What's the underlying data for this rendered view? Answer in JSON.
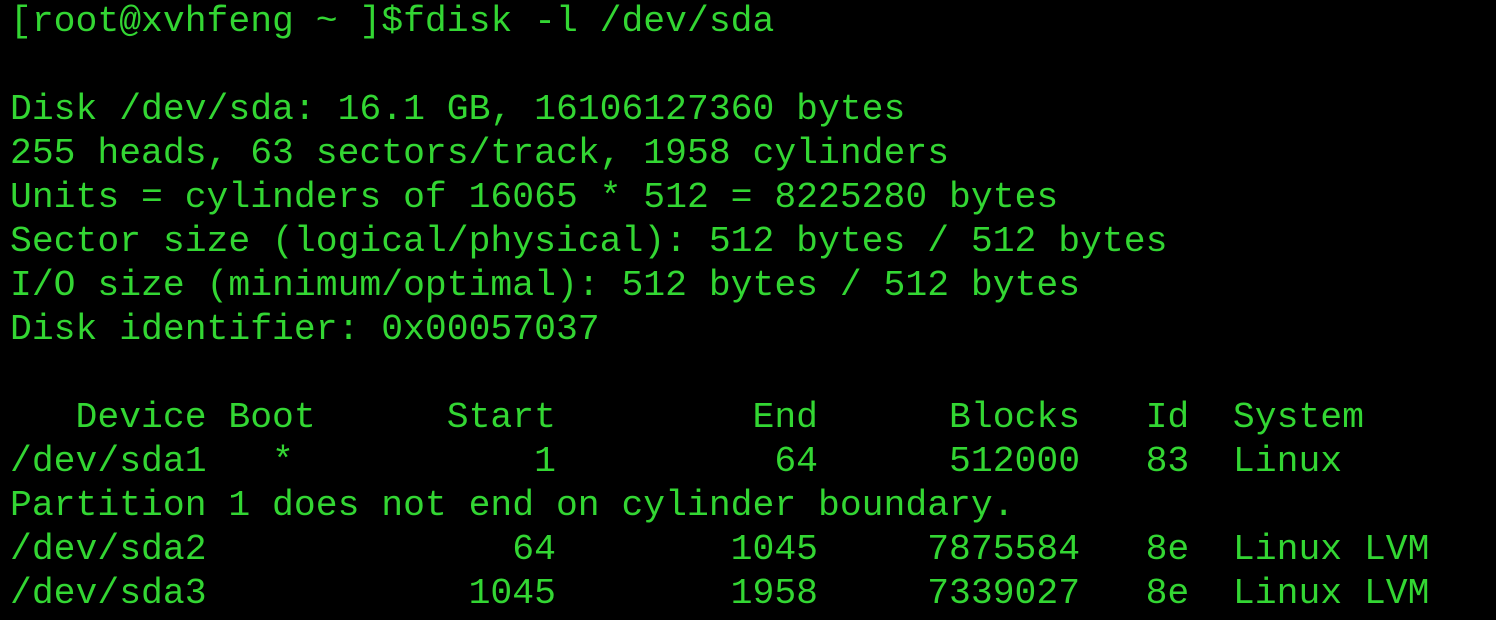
{
  "terminal": {
    "text_color": "#33d633",
    "background_color": "#000000",
    "prompt": "[root@xvhfeng ~ ]$",
    "command": "fdisk -l /dev/sda",
    "disk_info": [
      "Disk /dev/sda: 16.1 GB, 16106127360 bytes",
      "255 heads, 63 sectors/track, 1958 cylinders",
      "Units = cylinders of 16065 * 512 = 8225280 bytes",
      "Sector size (logical/physical): 512 bytes / 512 bytes",
      "I/O size (minimum/optimal): 512 bytes / 512 bytes",
      "Disk identifier: 0x00057037"
    ],
    "partition_table": {
      "header": "   Device Boot      Start         End      Blocks   Id  System",
      "columns": [
        "Device",
        "Boot",
        "Start",
        "End",
        "Blocks",
        "Id",
        "System"
      ],
      "rows": [
        {
          "device": "/dev/sda1",
          "boot": "*",
          "start": "1",
          "end": "64",
          "blocks": "512000",
          "id": "83",
          "system": "Linux",
          "text": "/dev/sda1   *           1          64      512000   83  Linux"
        },
        {
          "device": "/dev/sda2",
          "boot": "",
          "start": "64",
          "end": "1045",
          "blocks": "7875584",
          "id": "8e",
          "system": "Linux LVM",
          "text": "/dev/sda2              64        1045     7875584   8e  Linux LVM"
        },
        {
          "device": "/dev/sda3",
          "boot": "",
          "start": "1045",
          "end": "1958",
          "blocks": "7339027",
          "id": "8e",
          "system": "Linux LVM",
          "text": "/dev/sda3            1045        1958     7339027   8e  Linux LVM"
        }
      ],
      "warning": "Partition 1 does not end on cylinder boundary."
    }
  }
}
